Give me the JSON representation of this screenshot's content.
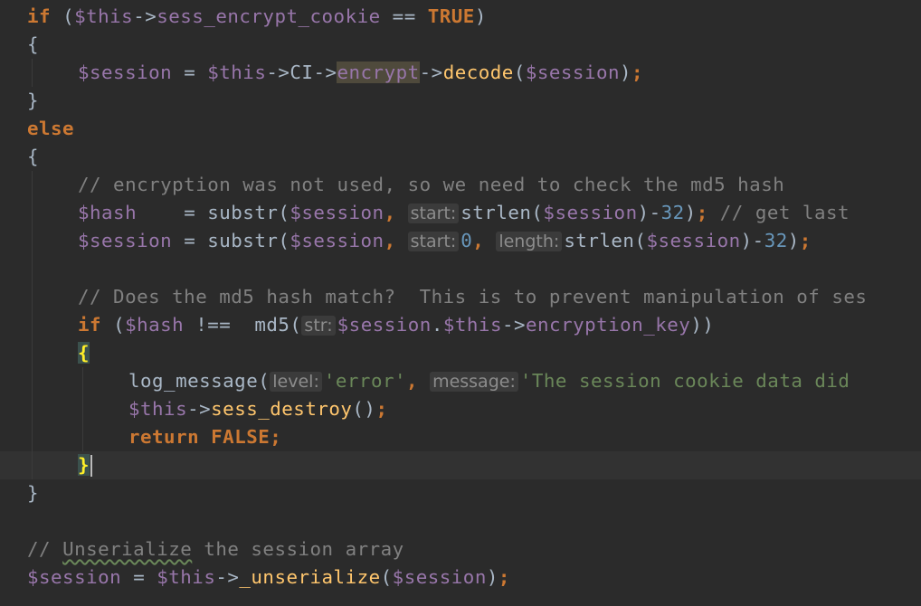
{
  "code": {
    "l1": {
      "kw": "if",
      "open": " (",
      "var": "$this",
      "arrow": "->",
      "prop": "sess_encrypt_cookie",
      "eq": " == ",
      "const": "TRUE",
      "close": ")"
    },
    "l2": {
      "brace": "{"
    },
    "l3": {
      "var1": "$session",
      "assign": " = ",
      "var2": "$this",
      "a1": "->",
      "ci": "CI",
      "a2": "->",
      "encrypt": "encrypt",
      "a3": "->",
      "fn": "decode",
      "p1": "(",
      "var3": "$session",
      "p2": ")",
      "semi": ";"
    },
    "l4": {
      "brace": "}"
    },
    "l5": {
      "kw": "else"
    },
    "l6": {
      "brace": "{"
    },
    "l7": {
      "comment": "// encryption was not used, so we need to check the md5 hash"
    },
    "l8": {
      "var1": "$hash",
      "pad": "    = ",
      "fn": "substr",
      "p1": "(",
      "var2": "$session",
      "comma": ", ",
      "hint_start": "start:",
      "fn2": "strlen",
      "p2": "(",
      "var3": "$session",
      "p3": ")",
      "minus": "-",
      "num": "32",
      "p4": ")",
      "semi": ";",
      "comment": " // get last"
    },
    "l9": {
      "var1": "$session",
      "assign": " = ",
      "fn": "substr",
      "p1": "(",
      "var2": "$session",
      "comma": ", ",
      "hint_start": "start:",
      "num0": "0",
      "comma2": ", ",
      "hint_length": "length:",
      "fn2": "strlen",
      "p2": "(",
      "var3": "$session",
      "p3": ")",
      "minus": "-",
      "num": "32",
      "p4": ")",
      "semi": ";"
    },
    "l10": {},
    "l11": {
      "comment": "// Does the md5 hash match?  This is to prevent manipulation of ses"
    },
    "l12": {
      "kw": "if",
      "open": " (",
      "var1": "$hash",
      "neq": " !==  ",
      "fn": "md5",
      "p1": "(",
      "hint_str": "str:",
      "var2": "$session",
      "dot": ".",
      "var3": "$this",
      "arrow": "->",
      "prop": "encryption_key",
      "close": "))"
    },
    "l13": {
      "brace": "{"
    },
    "l14": {
      "fn": "log_message",
      "p1": "(",
      "hint_level": "level:",
      "str1": "'error'",
      "comma": ", ",
      "hint_message": "message:",
      "str2": "'The session cookie data did"
    },
    "l15": {
      "var": "$this",
      "arrow": "->",
      "fn": "sess_destroy",
      "call": "()",
      "semi": ";"
    },
    "l16": {
      "kw": "return",
      "sp": " ",
      "const": "FALSE",
      "semi": ";"
    },
    "l17": {
      "brace": "}"
    },
    "l18": {
      "brace": "}"
    },
    "l19": {},
    "l20": {
      "c1": "// ",
      "c2": "Unserialize",
      "c3": " the session array"
    },
    "l21": {
      "var1": "$session",
      "assign": " = ",
      "var2": "$this",
      "arrow": "->",
      "fn": "_unserialize",
      "p1": "(",
      "var3": "$session",
      "p2": ")",
      "semi": ";"
    }
  },
  "colors": {
    "background": "#2b2b2b",
    "keyword": "#cc7832",
    "variable": "#9876aa",
    "function": "#ffc66d",
    "number": "#6897bb",
    "string": "#6a8759",
    "comment": "#808080",
    "text": "#a9b7c6"
  }
}
